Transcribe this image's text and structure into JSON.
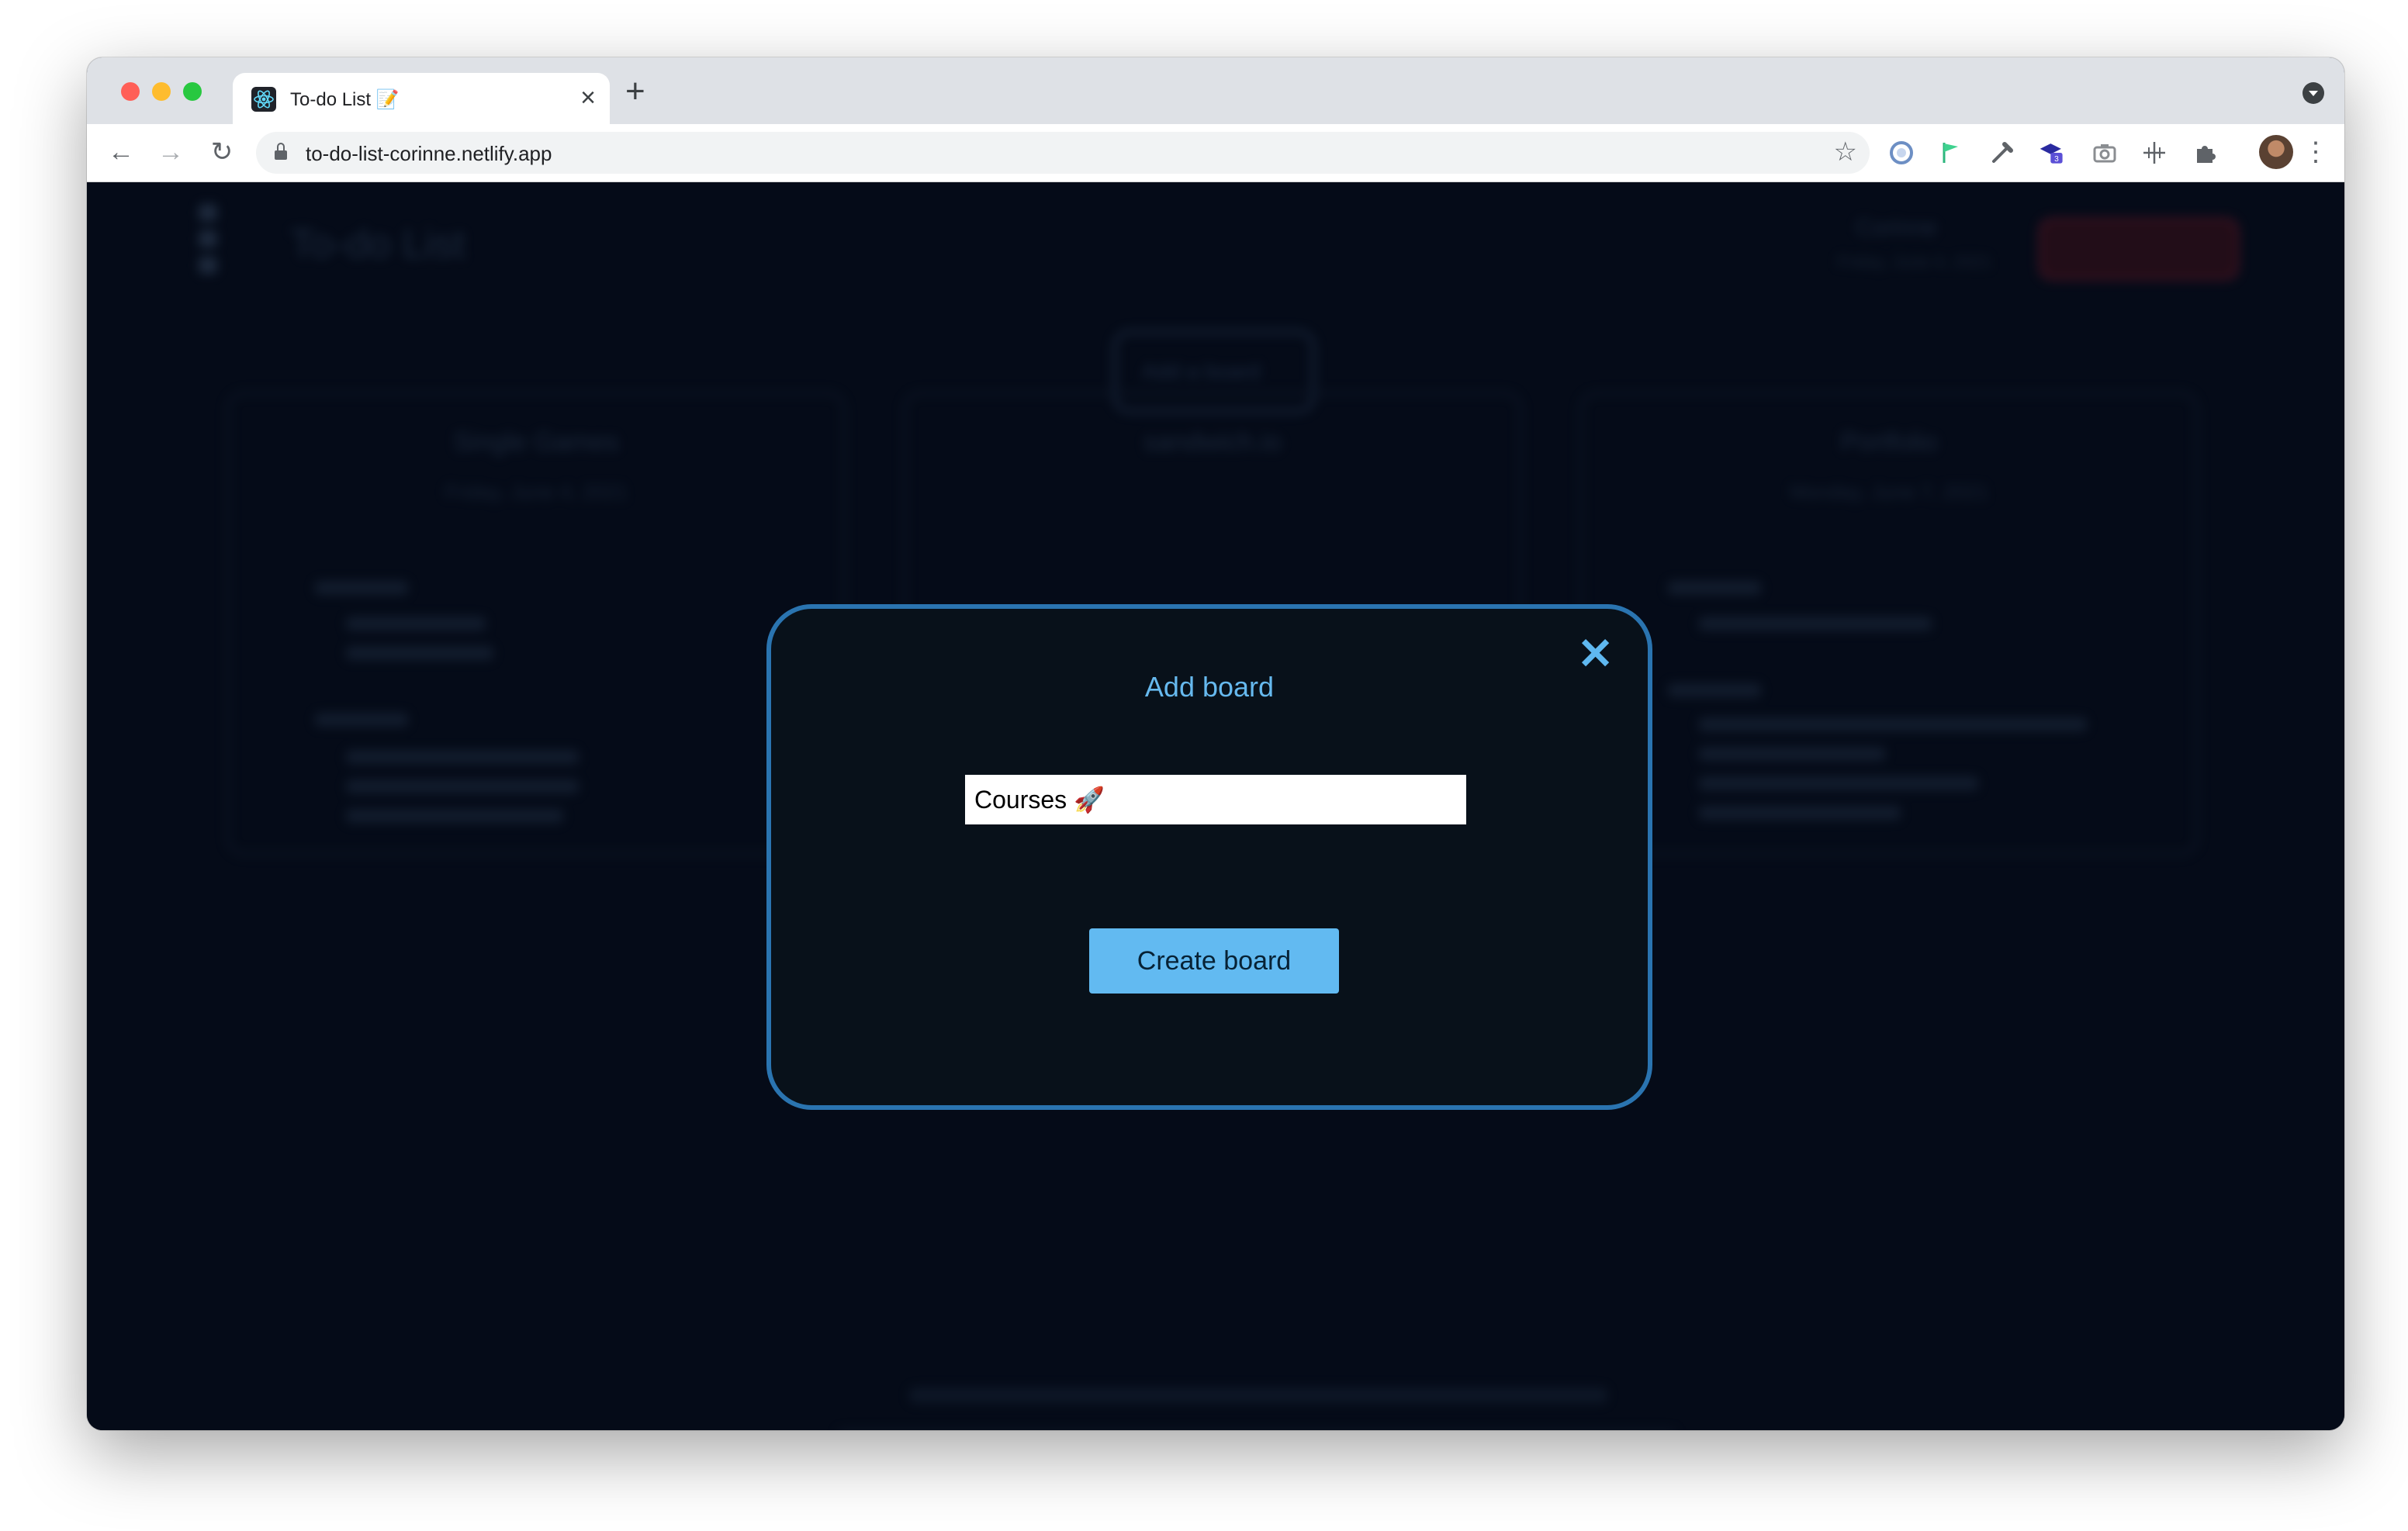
{
  "browser": {
    "tab_title": "To-do List 📝",
    "tab_close": "×",
    "new_tab": "+",
    "url": "to-do-list-corinne.netlify.app",
    "back": "←",
    "forward": "→",
    "reload": "↻",
    "star": "☆",
    "menu": "⋮",
    "extension_badge": "3"
  },
  "app": {
    "title": "To-do List",
    "user_name": "Corinne",
    "user_date": "Friday, June 4, 2021",
    "add_board_label": "Add a board",
    "boards": [
      {
        "title": "Single Games",
        "date": "Friday, June 4, 2021"
      },
      {
        "title": "sandwich.io",
        "date": ""
      },
      {
        "title": "Portfolio",
        "date": "Monday, June 7, 2021"
      }
    ]
  },
  "modal": {
    "title": "Add board",
    "close": "✕",
    "input_value": "Courses 🚀",
    "submit_label": "Create board"
  }
}
